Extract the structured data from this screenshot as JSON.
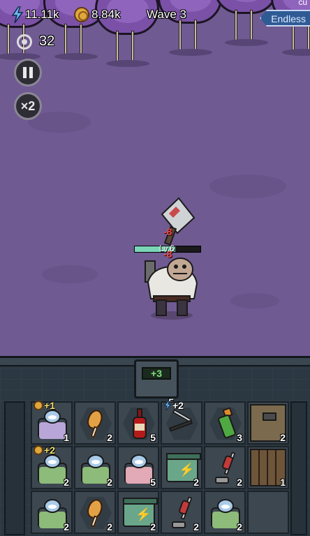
{
  "hud": {
    "energy": "11.11k",
    "coins": "8.84k",
    "wave": "Wave 3",
    "mode": "Endless",
    "corner_text": "cu",
    "kill_count": "32",
    "speed_label": "×2"
  },
  "enemy": {
    "level": "Lv.6",
    "hp_fraction": 0.62,
    "damage_numbers": [
      "-8",
      "-8"
    ]
  },
  "board": {
    "tray_value": "+3",
    "tray_count": "5",
    "rows": [
      [
        {
          "item": "bed-icon",
          "blanket": "#b9a6d9",
          "qty": "1",
          "bonus": "+1",
          "bonus_type": "coin"
        },
        {
          "item": "chicken-leg-icon",
          "qty": "2",
          "hex": true
        },
        {
          "item": "bottle-icon",
          "qty": "5",
          "hex": true
        },
        {
          "item": "knife-icon",
          "qty": "",
          "bonus": "+2",
          "bonus_type": "energy",
          "hex": true
        },
        {
          "item": "spray-can-icon",
          "qty": "3",
          "hex": true
        },
        {
          "item": "drawer-icon",
          "qty": "2"
        }
      ],
      [
        {
          "item": "bed-icon",
          "blanket": "#8dbb7a",
          "qty": "2",
          "bonus": "+2",
          "bonus_type": "coin"
        },
        {
          "item": "bed-icon",
          "blanket": "#8dbb7a",
          "qty": "2"
        },
        {
          "item": "bed-icon",
          "blanket": "#e2a9b6",
          "qty": "5"
        },
        {
          "item": "battery-icon",
          "qty": "2"
        },
        {
          "item": "vacuum-icon",
          "qty": "2"
        },
        {
          "item": "door-icon",
          "qty": "1"
        }
      ],
      [
        {
          "item": "bed-icon",
          "blanket": "#8dbb7a",
          "qty": "2"
        },
        {
          "item": "chicken-leg-icon",
          "qty": "2",
          "hex": true
        },
        {
          "item": "battery-icon",
          "qty": "2"
        },
        {
          "item": "vacuum-icon",
          "qty": "2"
        },
        {
          "item": "bed-icon",
          "blanket": "#8dbb7a",
          "qty": "2"
        },
        {
          "item": "empty",
          "qty": ""
        }
      ]
    ]
  },
  "colors": {
    "field": "#6f5a92",
    "board": "#2b3741",
    "hp": "#7bd6b8",
    "coin": "#e0a73b"
  }
}
